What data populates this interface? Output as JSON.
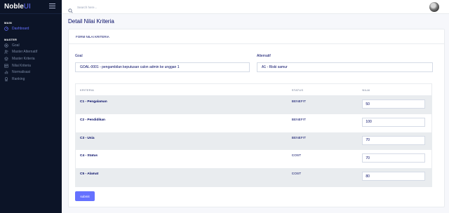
{
  "app": {
    "brand_main": "Noble",
    "brand_accent": "UI"
  },
  "colors": {
    "accent": "#6571ff",
    "sidebar_bg": "#0c1427",
    "row_alt": "#e9ecef"
  },
  "sidebar": {
    "main_label": "MAIN",
    "main_items": [
      {
        "label": "Dashboard",
        "icon": "dashboard-icon"
      }
    ],
    "master_label": "MASTER",
    "master_items": [
      {
        "label": "Goal",
        "icon": "target-icon"
      },
      {
        "label": "Master Alternatif",
        "icon": "users-icon"
      },
      {
        "label": "Master Kriteria",
        "icon": "layers-icon"
      },
      {
        "label": "Nilai Kriteria",
        "icon": "table-icon"
      },
      {
        "label": "Normalisasi",
        "icon": "bar-chart-icon"
      },
      {
        "label": "Ranking",
        "icon": "award-icon"
      }
    ]
  },
  "topbar": {
    "search_placeholder": "Search here..."
  },
  "page": {
    "title": "Detail Nilai Kriteria",
    "card_header": "FORM NILAI KRITERIA",
    "goal_label": "Goal",
    "goal_value": "GOAL-0001 - pengambilan keputusan calon admin ke unggan 1",
    "alternatif_label": "Alternatif",
    "alternatif_value": "A1 - Riski samur",
    "submit_label": "submit"
  },
  "table": {
    "headers": [
      "KRITERIA",
      "STATUS",
      "NILAI"
    ],
    "rows": [
      {
        "kriteria": "C1 - Pengalaman",
        "status": "BENEFIT",
        "nilai": "50"
      },
      {
        "kriteria": "C2 - Pendidikan",
        "status": "BENEFIT",
        "nilai": "100"
      },
      {
        "kriteria": "C3 - Usia",
        "status": "BENEFIT",
        "nilai": "70"
      },
      {
        "kriteria": "C4 - Status",
        "status": "COST",
        "nilai": "70"
      },
      {
        "kriteria": "C5 - Alamat",
        "status": "COST",
        "nilai": "80"
      }
    ]
  }
}
